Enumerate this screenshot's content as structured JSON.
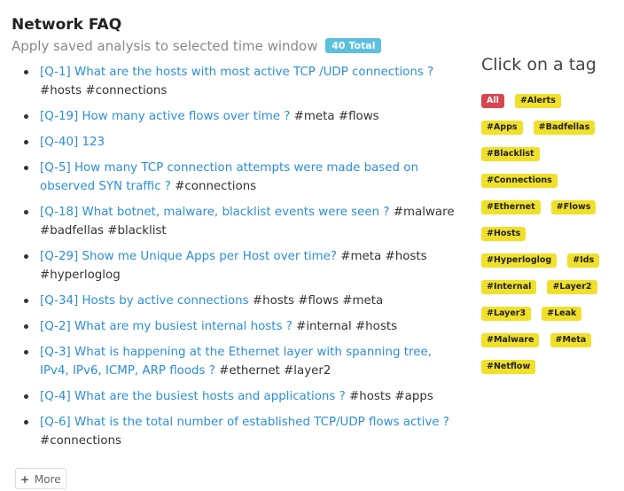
{
  "header": {
    "title": "Network FAQ",
    "subtitle": "Apply saved analysis to selected time window",
    "total_badge": "40 Total"
  },
  "faq": [
    {
      "link": "[Q-1] What are the hosts with most active TCP /UDP connections ?",
      "tags": "#hosts #connections"
    },
    {
      "link": "[Q-19] How many active flows over time ?",
      "tags": "#meta #flows"
    },
    {
      "link": "[Q-40] 123",
      "tags": ""
    },
    {
      "link": "[Q-5] How many TCP connection attempts were made based on observed SYN traffic ?",
      "tags": "#connections"
    },
    {
      "link": "[Q-18] What botnet, malware, blacklist events were seen ?",
      "tags": "#malware #badfellas #blacklist"
    },
    {
      "link": "[Q-29] Show me Unique Apps per Host over time?",
      "tags": "#meta #hosts #hyperloglog"
    },
    {
      "link": "[Q-34] Hosts by active connections",
      "tags": "#hosts #flows #meta"
    },
    {
      "link": "[Q-2] What are my busiest internal hosts ?",
      "tags": "#internal #hosts"
    },
    {
      "link": "[Q-3] What is happening at the Ethernet layer with spanning tree, IPv4, IPv6, ICMP, ARP floods ?",
      "tags": "#ethernet #layer2"
    },
    {
      "link": "[Q-4] What are the busiest hosts and applications ?",
      "tags": "#hosts #apps"
    },
    {
      "link": "[Q-6] What is the total number of established TCP/UDP flows active ?",
      "tags": "#connections"
    }
  ],
  "more_button": {
    "icon": "plus-icon",
    "label": "More"
  },
  "tag_panel": {
    "title": "Click on a tag",
    "tags": [
      "All",
      "#Alerts",
      "#Apps",
      "#Badfellas",
      "#Blacklist",
      "#Connections",
      "#Ethernet",
      "#Flows",
      "#Hosts",
      "#Hyperloglog",
      "#Ids",
      "#Internal",
      "#Layer2",
      "#Layer3",
      "#Leak",
      "#Malware",
      "#Meta",
      "#Netflow"
    ],
    "active_tag": "All"
  },
  "colors": {
    "link": "#2b8ed9",
    "tag": "#f0e02a",
    "active_tag": "#d9454f",
    "badge": "#5bc0de"
  }
}
